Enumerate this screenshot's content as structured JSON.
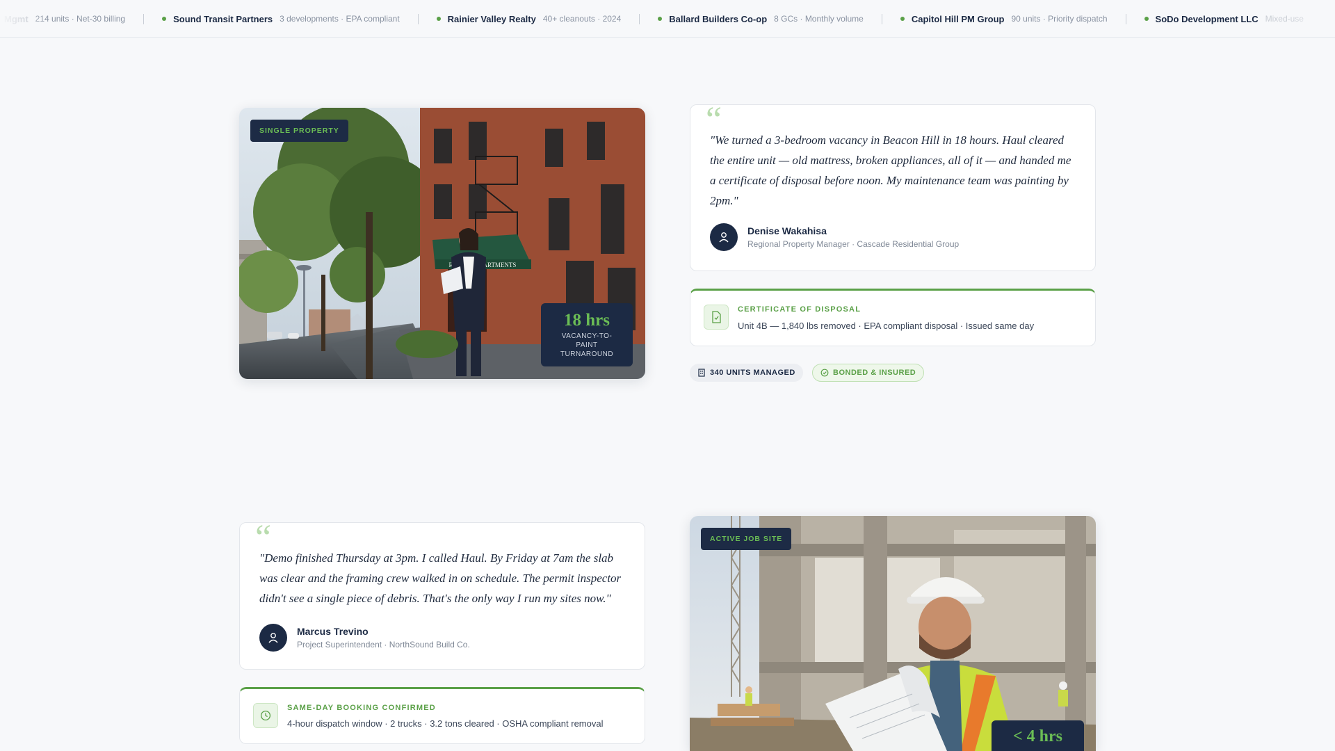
{
  "ticker": [
    {
      "name": "Mgmt",
      "detail": "214 units · Net-30 billing",
      "faded": true
    },
    {
      "name": "Sound Transit Partners",
      "detail": "3 developments · EPA compliant"
    },
    {
      "name": "Rainier Valley Realty",
      "detail": "40+ cleanouts · 2024"
    },
    {
      "name": "Ballard Builders Co-op",
      "detail": "8 GCs · Monthly volume"
    },
    {
      "name": "Capitol Hill PM Group",
      "detail": "90 units · Priority dispatch"
    },
    {
      "name": "SoDo Development LLC",
      "detail": "Mixed-use",
      "faded_detail": true
    }
  ],
  "case1": {
    "tag": "SINGLE PROPERTY",
    "sign_text": "RAINIER APARTMENTS",
    "stat_value": "18 hrs",
    "stat_label": "VACANCY-TO-PAINT TURNAROUND",
    "quote": "\"We turned a 3-bedroom vacancy in Beacon Hill in 18 hours. Haul cleared the entire unit — old mattress, broken appliances, all of it — and handed me a certificate of disposal before noon. My maintenance team was painting by 2pm.\"",
    "author_name": "Denise Wakahisa",
    "author_role": "Regional Property Manager · Cascade Residential Group",
    "info_title": "CERTIFICATE OF DISPOSAL",
    "info_desc": "Unit 4B — 1,840 lbs removed · EPA compliant disposal · Issued same day",
    "badge_units": "340 UNITS MANAGED",
    "badge_bonded": "BONDED & INSURED"
  },
  "case2": {
    "tag": "ACTIVE JOB SITE",
    "stat_value": "< 4 hrs",
    "quote": "\"Demo finished Thursday at 3pm. I called Haul. By Friday at 7am the slab was clear and the framing crew walked in on schedule. The permit inspector didn't see a single piece of debris. That's the only way I run my sites now.\"",
    "author_name": "Marcus Trevino",
    "author_role": "Project Superintendent · NorthSound Build Co.",
    "info_title": "SAME-DAY BOOKING CONFIRMED",
    "info_desc": "4-hour dispatch window · 2 trucks · 3.2 tons cleared · OSHA compliant removal"
  },
  "colors": {
    "navy": "#1c2a44",
    "green": "#5aa047",
    "bg": "#f7f8fa"
  }
}
